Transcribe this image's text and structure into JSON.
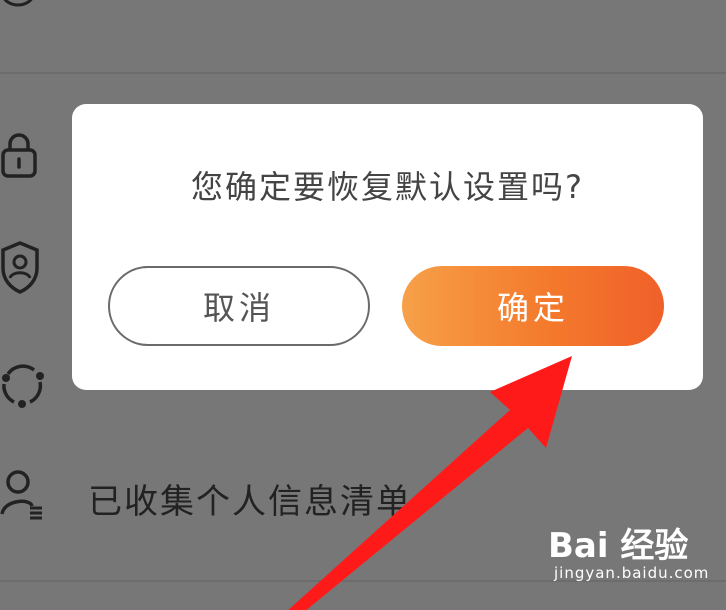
{
  "background_list": {
    "items": [
      {
        "label": "",
        "icon": "guard-icon"
      },
      {
        "label": "",
        "icon": "lock-icon"
      },
      {
        "label": "",
        "icon": "shield-user-icon"
      },
      {
        "label": "",
        "icon": "share-circle-icon"
      },
      {
        "label": "已收集个人信息清单",
        "icon": "user-list-icon"
      }
    ],
    "partial_top_text": "",
    "partial_third_text": ""
  },
  "dialog": {
    "message": "您确定要恢复默认设置吗?",
    "cancel_label": "取消",
    "confirm_label": "确定"
  },
  "watermark": {
    "logo": "Bai 经验",
    "url": "jingyan.baidu.com"
  },
  "colors": {
    "overlay": "#777777",
    "dialog_bg": "#ffffff",
    "confirm_gradient_start": "#f7a049",
    "confirm_gradient_end": "#f0602a",
    "arrow": "#ff1a1a"
  }
}
